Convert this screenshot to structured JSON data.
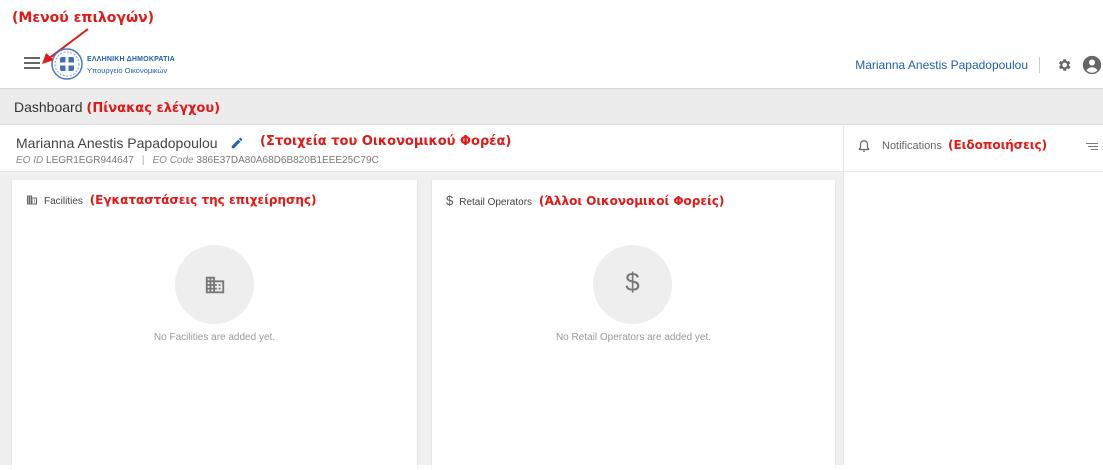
{
  "annotations": {
    "menu": "(Μενού επιλογών)",
    "dashboard": "(Πίνακας ελέγχου)",
    "eo_details": "(Στοιχεία του Οικονομικού Φορέα)",
    "facilities": "(Εγκαταστάσεις της επιχείρησης)",
    "retail": "(Άλλοι Οικονομικοί Φορείς)",
    "notifications": "(Ειδοποιήσεις)"
  },
  "header": {
    "logo_line1": "ΕΛΛΗΝΙΚΗ ΔΗΜΟΚΡΑΤΙΑ",
    "logo_line2": "Υπουργείο Οικονομικών",
    "user_name": "Marianna Anestis Papadopoulou",
    "icons": [
      "menu-icon",
      "gear-icon",
      "account-icon"
    ]
  },
  "dashboard": {
    "title": "Dashboard"
  },
  "eo": {
    "name": "Marianna Anestis Papadopoulou",
    "id_label": "EO ID",
    "id_value": "LEGR1EGR944647",
    "code_label": "EO Code",
    "code_value": "386E37DA80A68D6B820B1EEE25C79C"
  },
  "facilities": {
    "title": "Facilities",
    "empty": "No Facilities are added yet."
  },
  "retail": {
    "title": "Retail Operators",
    "empty": "No Retail Operators are added yet."
  },
  "notifications": {
    "title": "Notifications"
  },
  "colors": {
    "accent": "#1f5fae",
    "annotation": "#e01919",
    "bar": "#ececec"
  }
}
